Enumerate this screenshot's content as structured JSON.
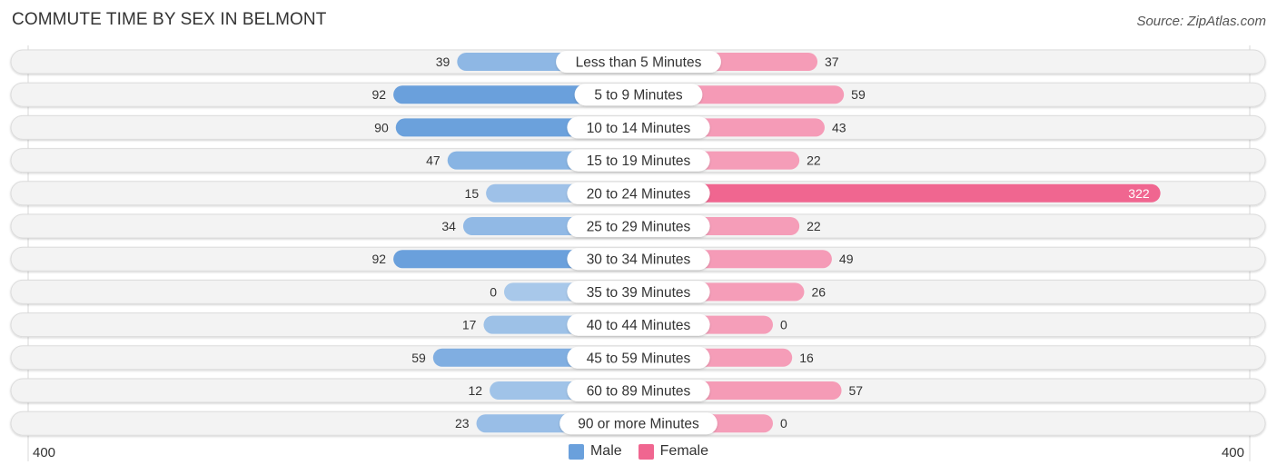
{
  "header": {
    "title": "COMMUTE TIME BY SEX IN BELMONT",
    "source": "Source: ZipAtlas.com"
  },
  "colors": {
    "male": "#6aa0dc",
    "male_light": "#a8c8ea",
    "female": "#f06690",
    "female_light": "#f6a8c0"
  },
  "chart_data": {
    "type": "bar",
    "orientation": "horizontal-diverging",
    "title": "COMMUTE TIME BY SEX IN BELMONT",
    "categories": [
      "Less than 5 Minutes",
      "5 to 9 Minutes",
      "10 to 14 Minutes",
      "15 to 19 Minutes",
      "20 to 24 Minutes",
      "25 to 29 Minutes",
      "30 to 34 Minutes",
      "35 to 39 Minutes",
      "40 to 44 Minutes",
      "45 to 59 Minutes",
      "60 to 89 Minutes",
      "90 or more Minutes"
    ],
    "series": [
      {
        "name": "Male",
        "values": [
          39,
          92,
          90,
          47,
          15,
          34,
          92,
          0,
          17,
          59,
          12,
          23
        ]
      },
      {
        "name": "Female",
        "values": [
          37,
          59,
          43,
          22,
          322,
          22,
          49,
          26,
          0,
          16,
          57,
          0
        ]
      }
    ],
    "axis_min_label": "400",
    "axis_max_label": "400",
    "xlim": [
      -400,
      400
    ],
    "legend": [
      "Male",
      "Female"
    ],
    "legend_position": "bottom-center",
    "grid": false
  }
}
